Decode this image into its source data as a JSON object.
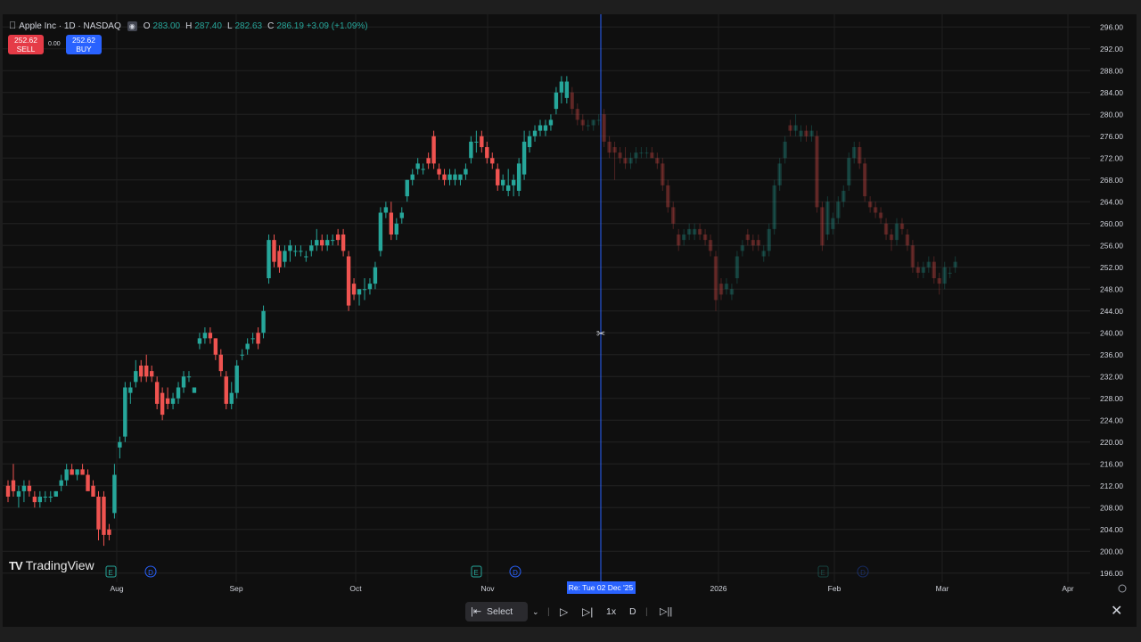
{
  "header": {
    "symbol_icon": "apple-icon",
    "title": "Apple Inc · 1D · NASDAQ",
    "ohlc": [
      {
        "k": "O",
        "v": "283.00"
      },
      {
        "k": "H",
        "v": "287.40"
      },
      {
        "k": "L",
        "v": "282.63"
      },
      {
        "k": "C",
        "v": "286.19 +3.09 (+1.09%)"
      }
    ]
  },
  "trade": {
    "sell_price": "252.62",
    "sell_label": "SELL",
    "spread": "0.00",
    "buy_price": "252.62",
    "buy_label": "BUY"
  },
  "logo": {
    "text": "TradingView"
  },
  "price_axis": {
    "labels": [
      "296.00",
      "292.00",
      "288.00",
      "284.00",
      "280.00",
      "276.00",
      "272.00",
      "268.00",
      "264.00",
      "260.00",
      "256.00",
      "252.00",
      "248.00",
      "244.00",
      "240.00",
      "236.00",
      "232.00",
      "228.00",
      "224.00",
      "220.00",
      "216.00",
      "212.00",
      "208.00",
      "204.00",
      "200.00",
      "196.00"
    ]
  },
  "time_axis": {
    "labels": [
      "Aug",
      "Sep",
      "Oct",
      "Nov",
      "2026",
      "Feb",
      "Mar",
      "Apr"
    ],
    "crosshair_label": "Re: Tue 02 Dec '25"
  },
  "events": [
    {
      "type": "E",
      "icon": "earnings-icon"
    },
    {
      "type": "D",
      "icon": "dividend-icon"
    },
    {
      "type": "E",
      "icon": "earnings-icon"
    },
    {
      "type": "D",
      "icon": "dividend-icon"
    },
    {
      "type": "E",
      "icon": "earnings-icon"
    },
    {
      "type": "D",
      "icon": "dividend-icon"
    }
  ],
  "replay": {
    "select_bar_label": "Select bar",
    "speed_label": "1x",
    "interval_label": "D",
    "icons": [
      "select-bar-icon",
      "chevron-down-icon",
      "play-icon",
      "step-forward-icon",
      "jump-to-realtime-icon",
      "close-icon"
    ]
  },
  "colors": {
    "up": "#26a69a",
    "down": "#ef5350",
    "crosshair": "#2962ff",
    "background": "#0f0f0f"
  },
  "chart_data": {
    "type": "candlestick",
    "ylim": [
      194,
      298
    ],
    "active_candles": [
      {
        "o": 212,
        "h": 213,
        "l": 209,
        "c": 210
      },
      {
        "o": 213,
        "h": 216,
        "l": 210,
        "c": 211
      },
      {
        "o": 210,
        "h": 212,
        "l": 208,
        "c": 211
      },
      {
        "o": 211,
        "h": 213,
        "l": 209,
        "c": 212
      },
      {
        "o": 212,
        "h": 213,
        "l": 210,
        "c": 211
      },
      {
        "o": 210,
        "h": 211,
        "l": 208,
        "c": 209
      },
      {
        "o": 209,
        "h": 211,
        "l": 208,
        "c": 210
      },
      {
        "o": 210,
        "h": 211,
        "l": 209,
        "c": 210
      },
      {
        "o": 210,
        "h": 211,
        "l": 209,
        "c": 210
      },
      {
        "o": 210,
        "h": 211,
        "l": 210,
        "c": 211
      },
      {
        "o": 212,
        "h": 214,
        "l": 211,
        "c": 213
      },
      {
        "o": 213,
        "h": 216,
        "l": 212,
        "c": 215
      },
      {
        "o": 215,
        "h": 216,
        "l": 214,
        "c": 214
      },
      {
        "o": 214,
        "h": 215,
        "l": 213,
        "c": 215
      },
      {
        "o": 215,
        "h": 216,
        "l": 214,
        "c": 214
      },
      {
        "o": 214,
        "h": 215,
        "l": 212,
        "c": 211
      },
      {
        "o": 212,
        "h": 213,
        "l": 210,
        "c": 210
      },
      {
        "o": 210,
        "h": 211,
        "l": 202,
        "c": 204
      },
      {
        "o": 210,
        "h": 211,
        "l": 201,
        "c": 203
      },
      {
        "o": 204,
        "h": 205,
        "l": 202,
        "c": 203
      },
      {
        "o": 207,
        "h": 216,
        "l": 206,
        "c": 214
      },
      {
        "o": 219,
        "h": 221,
        "l": 217,
        "c": 220
      },
      {
        "o": 221,
        "h": 231,
        "l": 220,
        "c": 230
      },
      {
        "o": 229,
        "h": 231,
        "l": 227,
        "c": 230
      },
      {
        "o": 231,
        "h": 235,
        "l": 230,
        "c": 233
      },
      {
        "o": 234,
        "h": 235,
        "l": 231,
        "c": 232
      },
      {
        "o": 234,
        "h": 236,
        "l": 231,
        "c": 232
      },
      {
        "o": 233,
        "h": 234,
        "l": 231,
        "c": 232
      },
      {
        "o": 231,
        "h": 232,
        "l": 226,
        "c": 227
      },
      {
        "o": 229,
        "h": 230,
        "l": 224,
        "c": 225
      },
      {
        "o": 228,
        "h": 230,
        "l": 226,
        "c": 227
      },
      {
        "o": 227,
        "h": 229,
        "l": 226,
        "c": 228
      },
      {
        "o": 228,
        "h": 231,
        "l": 227,
        "c": 230
      },
      {
        "o": 230,
        "h": 233,
        "l": 229,
        "c": 232
      },
      {
        "o": 232,
        "h": 233,
        "l": 231,
        "c": 232
      },
      {
        "o": 229,
        "h": 230,
        "l": 229,
        "c": 230
      },
      {
        "o": 238,
        "h": 240,
        "l": 237,
        "c": 239
      },
      {
        "o": 239,
        "h": 241,
        "l": 238,
        "c": 240
      },
      {
        "o": 240,
        "h": 241,
        "l": 238,
        "c": 239
      },
      {
        "o": 239,
        "h": 239,
        "l": 235,
        "c": 236
      },
      {
        "o": 236,
        "h": 237,
        "l": 232,
        "c": 233
      },
      {
        "o": 232,
        "h": 233,
        "l": 226,
        "c": 227
      },
      {
        "o": 227,
        "h": 231,
        "l": 226,
        "c": 229
      },
      {
        "o": 229,
        "h": 235,
        "l": 228,
        "c": 234
      },
      {
        "o": 236,
        "h": 237,
        "l": 235,
        "c": 236
      },
      {
        "o": 237,
        "h": 239,
        "l": 236,
        "c": 238
      },
      {
        "o": 239,
        "h": 240,
        "l": 238,
        "c": 239
      },
      {
        "o": 240,
        "h": 241,
        "l": 237,
        "c": 238
      },
      {
        "o": 240,
        "h": 245,
        "l": 239,
        "c": 244
      },
      {
        "o": 250,
        "h": 258,
        "l": 249,
        "c": 257
      },
      {
        "o": 257,
        "h": 258,
        "l": 252,
        "c": 253
      },
      {
        "o": 255,
        "h": 256,
        "l": 251,
        "c": 252
      },
      {
        "o": 253,
        "h": 256,
        "l": 252,
        "c": 255
      },
      {
        "o": 255,
        "h": 257,
        "l": 253,
        "c": 256
      },
      {
        "o": 255,
        "h": 256,
        "l": 254,
        "c": 255
      },
      {
        "o": 255,
        "h": 256,
        "l": 254,
        "c": 255
      },
      {
        "o": 254,
        "h": 255,
        "l": 253,
        "c": 254
      },
      {
        "o": 255,
        "h": 257,
        "l": 254,
        "c": 256
      },
      {
        "o": 256,
        "h": 259,
        "l": 255,
        "c": 257
      },
      {
        "o": 257,
        "h": 258,
        "l": 255,
        "c": 256
      },
      {
        "o": 256,
        "h": 258,
        "l": 255,
        "c": 257
      },
      {
        "o": 257,
        "h": 258,
        "l": 256,
        "c": 257
      },
      {
        "o": 258,
        "h": 259,
        "l": 256,
        "c": 257
      },
      {
        "o": 258,
        "h": 259,
        "l": 254,
        "c": 255
      },
      {
        "o": 254,
        "h": 255,
        "l": 244,
        "c": 245
      },
      {
        "o": 249,
        "h": 250,
        "l": 246,
        "c": 247
      },
      {
        "o": 247,
        "h": 248,
        "l": 245,
        "c": 248
      },
      {
        "o": 248,
        "h": 250,
        "l": 246,
        "c": 248
      },
      {
        "o": 248,
        "h": 250,
        "l": 247,
        "c": 249
      },
      {
        "o": 249,
        "h": 253,
        "l": 248,
        "c": 252
      },
      {
        "o": 255,
        "h": 263,
        "l": 254,
        "c": 262
      },
      {
        "o": 262,
        "h": 264,
        "l": 261,
        "c": 263
      },
      {
        "o": 262,
        "h": 264,
        "l": 257,
        "c": 258
      },
      {
        "o": 258,
        "h": 261,
        "l": 257,
        "c": 260
      },
      {
        "o": 261,
        "h": 263,
        "l": 260,
        "c": 262
      },
      {
        "o": 265,
        "h": 268,
        "l": 264,
        "c": 268
      },
      {
        "o": 268,
        "h": 270,
        "l": 267,
        "c": 269
      },
      {
        "o": 270,
        "h": 272,
        "l": 269,
        "c": 271
      },
      {
        "o": 270,
        "h": 271,
        "l": 269,
        "c": 270
      },
      {
        "o": 272,
        "h": 273,
        "l": 270,
        "c": 271
      },
      {
        "o": 276,
        "h": 277,
        "l": 270,
        "c": 271
      },
      {
        "o": 270,
        "h": 271,
        "l": 268,
        "c": 269
      },
      {
        "o": 269,
        "h": 270,
        "l": 267,
        "c": 268
      },
      {
        "o": 268,
        "h": 270,
        "l": 267,
        "c": 269
      },
      {
        "o": 268,
        "h": 270,
        "l": 267,
        "c": 269
      },
      {
        "o": 268,
        "h": 269,
        "l": 267,
        "c": 269
      },
      {
        "o": 269,
        "h": 271,
        "l": 268,
        "c": 270
      },
      {
        "o": 272,
        "h": 276,
        "l": 271,
        "c": 275
      },
      {
        "o": 275,
        "h": 277,
        "l": 273,
        "c": 275
      },
      {
        "o": 276,
        "h": 277,
        "l": 273,
        "c": 274
      },
      {
        "o": 274,
        "h": 275,
        "l": 271,
        "c": 272
      },
      {
        "o": 272,
        "h": 273,
        "l": 270,
        "c": 271
      },
      {
        "o": 270,
        "h": 271,
        "l": 266,
        "c": 267
      },
      {
        "o": 267,
        "h": 269,
        "l": 266,
        "c": 268
      },
      {
        "o": 266,
        "h": 270,
        "l": 265,
        "c": 267
      },
      {
        "o": 267,
        "h": 269,
        "l": 265,
        "c": 268
      },
      {
        "o": 266,
        "h": 272,
        "l": 265,
        "c": 271
      },
      {
        "o": 269,
        "h": 277,
        "l": 268,
        "c": 275
      },
      {
        "o": 274,
        "h": 277,
        "l": 273,
        "c": 276
      },
      {
        "o": 276,
        "h": 278,
        "l": 275,
        "c": 277
      },
      {
        "o": 277,
        "h": 279,
        "l": 276,
        "c": 278
      },
      {
        "o": 277,
        "h": 279,
        "l": 276,
        "c": 278
      },
      {
        "o": 278,
        "h": 280,
        "l": 277,
        "c": 279
      },
      {
        "o": 281,
        "h": 285,
        "l": 280,
        "c": 284
      },
      {
        "o": 284,
        "h": 287,
        "l": 282,
        "c": 286
      },
      {
        "o": 283,
        "h": 287,
        "l": 282,
        "c": 286
      }
    ],
    "future_candles": [
      {
        "o": 284,
        "h": 285,
        "l": 280,
        "c": 281
      },
      {
        "o": 281,
        "h": 282,
        "l": 278,
        "c": 279
      },
      {
        "o": 279,
        "h": 280,
        "l": 277,
        "c": 278
      },
      {
        "o": 278,
        "h": 279,
        "l": 277,
        "c": 278
      },
      {
        "o": 278,
        "h": 279,
        "l": 277,
        "c": 279
      },
      {
        "o": 279,
        "h": 280,
        "l": 278,
        "c": 279
      },
      {
        "o": 280,
        "h": 281,
        "l": 274,
        "c": 275
      },
      {
        "o": 275,
        "h": 276,
        "l": 272,
        "c": 273
      },
      {
        "o": 274,
        "h": 275,
        "l": 268,
        "c": 273
      },
      {
        "o": 273,
        "h": 274,
        "l": 271,
        "c": 272
      },
      {
        "o": 272,
        "h": 274,
        "l": 270,
        "c": 271
      },
      {
        "o": 271,
        "h": 273,
        "l": 270,
        "c": 272
      },
      {
        "o": 272,
        "h": 274,
        "l": 271,
        "c": 273
      },
      {
        "o": 273,
        "h": 274,
        "l": 272,
        "c": 273
      },
      {
        "o": 273,
        "h": 274,
        "l": 272,
        "c": 273
      },
      {
        "o": 273,
        "h": 274,
        "l": 272,
        "c": 272
      },
      {
        "o": 272,
        "h": 273,
        "l": 270,
        "c": 271
      },
      {
        "o": 271,
        "h": 272,
        "l": 266,
        "c": 267
      },
      {
        "o": 267,
        "h": 268,
        "l": 262,
        "c": 263
      },
      {
        "o": 263,
        "h": 264,
        "l": 259,
        "c": 260
      },
      {
        "o": 258,
        "h": 259,
        "l": 255,
        "c": 256
      },
      {
        "o": 257,
        "h": 259,
        "l": 256,
        "c": 258
      },
      {
        "o": 258,
        "h": 260,
        "l": 257,
        "c": 259
      },
      {
        "o": 258,
        "h": 260,
        "l": 257,
        "c": 259
      },
      {
        "o": 259,
        "h": 260,
        "l": 257,
        "c": 258
      },
      {
        "o": 258,
        "h": 259,
        "l": 256,
        "c": 257
      },
      {
        "o": 257,
        "h": 258,
        "l": 254,
        "c": 255
      },
      {
        "o": 254,
        "h": 255,
        "l": 244,
        "c": 246
      },
      {
        "o": 249,
        "h": 250,
        "l": 246,
        "c": 247
      },
      {
        "o": 248,
        "h": 250,
        "l": 247,
        "c": 249
      },
      {
        "o": 247,
        "h": 249,
        "l": 246,
        "c": 248
      },
      {
        "o": 250,
        "h": 255,
        "l": 249,
        "c": 254
      },
      {
        "o": 255,
        "h": 257,
        "l": 254,
        "c": 256
      },
      {
        "o": 258,
        "h": 259,
        "l": 256,
        "c": 257
      },
      {
        "o": 257,
        "h": 258,
        "l": 255,
        "c": 256
      },
      {
        "o": 257,
        "h": 258,
        "l": 255,
        "c": 256
      },
      {
        "o": 254,
        "h": 256,
        "l": 253,
        "c": 255
      },
      {
        "o": 255,
        "h": 260,
        "l": 254,
        "c": 259
      },
      {
        "o": 259,
        "h": 268,
        "l": 258,
        "c": 267
      },
      {
        "o": 267,
        "h": 272,
        "l": 266,
        "c": 271
      },
      {
        "o": 272,
        "h": 276,
        "l": 271,
        "c": 275
      },
      {
        "o": 278,
        "h": 279,
        "l": 276,
        "c": 277
      },
      {
        "o": 277,
        "h": 280,
        "l": 276,
        "c": 278
      },
      {
        "o": 276,
        "h": 278,
        "l": 275,
        "c": 277
      },
      {
        "o": 277,
        "h": 278,
        "l": 275,
        "c": 276
      },
      {
        "o": 276,
        "h": 278,
        "l": 275,
        "c": 277
      },
      {
        "o": 276,
        "h": 277,
        "l": 262,
        "c": 263
      },
      {
        "o": 263,
        "h": 264,
        "l": 255,
        "c": 256
      },
      {
        "o": 258,
        "h": 265,
        "l": 257,
        "c": 264
      },
      {
        "o": 259,
        "h": 262,
        "l": 258,
        "c": 261
      },
      {
        "o": 261,
        "h": 265,
        "l": 260,
        "c": 264
      },
      {
        "o": 264,
        "h": 267,
        "l": 263,
        "c": 266
      },
      {
        "o": 267,
        "h": 273,
        "l": 266,
        "c": 272
      },
      {
        "o": 272,
        "h": 275,
        "l": 271,
        "c": 274
      },
      {
        "o": 274,
        "h": 275,
        "l": 270,
        "c": 271
      },
      {
        "o": 271,
        "h": 272,
        "l": 264,
        "c": 265
      },
      {
        "o": 264,
        "h": 265,
        "l": 262,
        "c": 263
      },
      {
        "o": 263,
        "h": 264,
        "l": 261,
        "c": 262
      },
      {
        "o": 262,
        "h": 263,
        "l": 260,
        "c": 261
      },
      {
        "o": 260,
        "h": 261,
        "l": 257,
        "c": 258
      },
      {
        "o": 258,
        "h": 259,
        "l": 255,
        "c": 257
      },
      {
        "o": 257,
        "h": 261,
        "l": 256,
        "c": 260
      },
      {
        "o": 260,
        "h": 261,
        "l": 258,
        "c": 259
      },
      {
        "o": 258,
        "h": 259,
        "l": 255,
        "c": 256
      },
      {
        "o": 256,
        "h": 257,
        "l": 251,
        "c": 252
      },
      {
        "o": 252,
        "h": 253,
        "l": 250,
        "c": 251
      },
      {
        "o": 251,
        "h": 253,
        "l": 250,
        "c": 252
      },
      {
        "o": 252,
        "h": 254,
        "l": 251,
        "c": 253
      },
      {
        "o": 253,
        "h": 254,
        "l": 249,
        "c": 250
      },
      {
        "o": 250,
        "h": 251,
        "l": 247,
        "c": 249
      },
      {
        "o": 249,
        "h": 253,
        "l": 248,
        "c": 252
      },
      {
        "o": 251,
        "h": 252,
        "l": 250,
        "c": 251
      },
      {
        "o": 252,
        "h": 254,
        "l": 251,
        "c": 253
      }
    ]
  }
}
